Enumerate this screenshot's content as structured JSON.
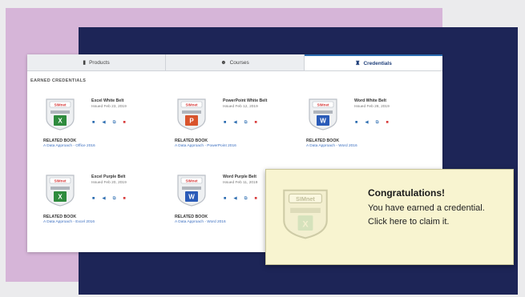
{
  "tabs": [
    {
      "label": "Products",
      "icon": "book-icon",
      "active": false
    },
    {
      "label": "Courses",
      "icon": "people-icon",
      "active": false
    },
    {
      "label": "Credentials",
      "icon": "certificate-icon",
      "active": true
    }
  ],
  "section_title": "EARNED CREDENTIALS",
  "related_book_label": "RELATED BOOK",
  "colors": {
    "excel": "#2e8b3d",
    "powerpoint": "#d9542c",
    "word": "#2a5bb8",
    "accent": "#2b6cb0",
    "toast_bg": "#f8f4d0"
  },
  "cards": [
    {
      "title": "Excel White Belt",
      "date": "Issued Feb 23, 2019",
      "book": "A Data Approach - Office 2016",
      "app": "excel"
    },
    {
      "title": "PowerPoint White Belt",
      "date": "Issued Feb 12, 2019",
      "book": "A Data Approach - PowerPoint 2016",
      "app": "powerpoint"
    },
    {
      "title": "Word White Belt",
      "date": "Issued Feb 28, 2019",
      "book": "A Data Approach - Word 2016",
      "app": "word"
    },
    {
      "title": "Excel Purple Belt",
      "date": "Issued Feb 20, 2019",
      "book": "A Data Approach - Excel 2016",
      "app": "excel"
    },
    {
      "title": "Word Purple Belt",
      "date": "Issued Feb 11, 2019",
      "book": "A Data Approach - Word 2016",
      "app": "word"
    }
  ],
  "badge_brand": "SIMnet",
  "toast": {
    "title": "Congratulations!",
    "body": "You have earned a credential. Click here to claim it."
  }
}
